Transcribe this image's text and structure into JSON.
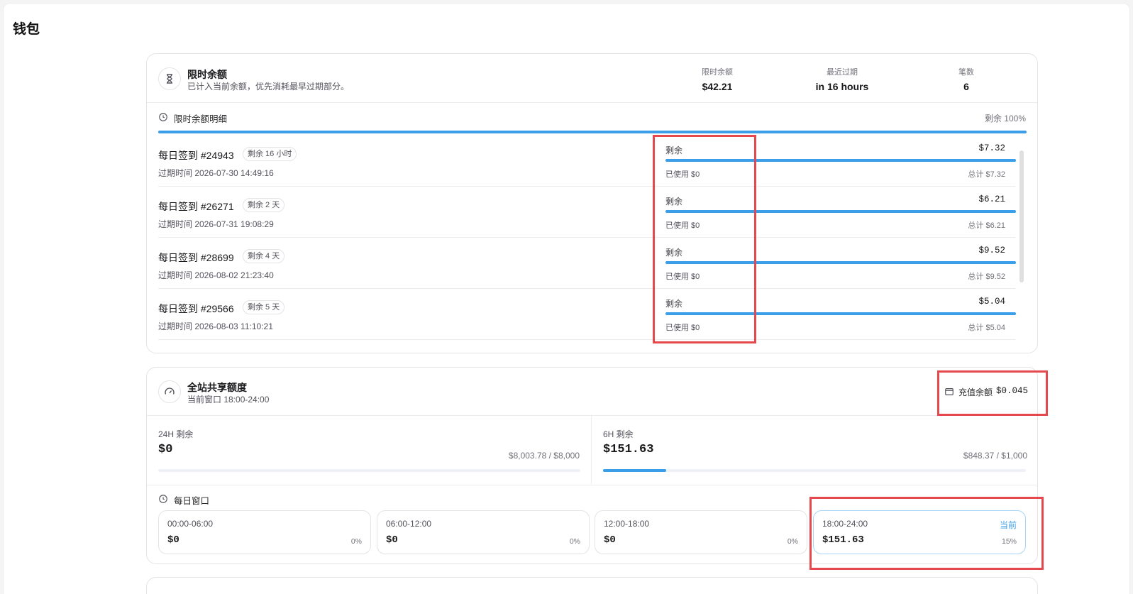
{
  "page": {
    "title": "钱包"
  },
  "limited": {
    "title": "限时余额",
    "subtitle": "已计入当前余额，优先消耗最早过期部分。",
    "stats": [
      {
        "label": "限时余额",
        "value": "$42.21"
      },
      {
        "label": "最近过期",
        "value": "in 16 hours"
      },
      {
        "label": "笔数",
        "value": "6"
      }
    ],
    "detail_title": "限时余额明细",
    "remaining_overall": "剩余 100%",
    "remaining_overall_pct": 100,
    "rows": [
      {
        "name": "每日签到 #24943",
        "badge": "剩余 16 小时",
        "expire": "过期时间 2026-07-30 14:49:16",
        "remain_label": "剩余",
        "remain_value": "$7.32",
        "used": "已使用 $0",
        "total": "总计 $7.32",
        "remain_pct": 100
      },
      {
        "name": "每日签到 #26271",
        "badge": "剩余 2 天",
        "expire": "过期时间 2026-07-31 19:08:29",
        "remain_label": "剩余",
        "remain_value": "$6.21",
        "used": "已使用 $0",
        "total": "总计 $6.21",
        "remain_pct": 100
      },
      {
        "name": "每日签到 #28699",
        "badge": "剩余 4 天",
        "expire": "过期时间 2026-08-02 21:23:40",
        "remain_label": "剩余",
        "remain_value": "$9.52",
        "used": "已使用 $0",
        "total": "总计 $9.52",
        "remain_pct": 100
      },
      {
        "name": "每日签到 #29566",
        "badge": "剩余 5 天",
        "expire": "过期时间 2026-08-03 11:10:21",
        "remain_label": "剩余",
        "remain_value": "$5.04",
        "used": "已使用 $0",
        "total": "总计 $5.04",
        "remain_pct": 100
      }
    ]
  },
  "shared": {
    "title": "全站共享额度",
    "subtitle": "当前窗口 18:00-24:00",
    "recharge_label": "充值余额",
    "recharge_value": "$0.045",
    "panes": [
      {
        "label": "24H 剩余",
        "value": "$0",
        "ratio": "$8,003.78 / $8,000",
        "remain_pct": 0
      },
      {
        "label": "6H 剩余",
        "value": "$151.63",
        "ratio": "$848.37 / $1,000",
        "remain_pct": 15
      }
    ],
    "daily_title": "每日窗口",
    "slots": [
      {
        "time": "00:00-06:00",
        "value": "$0",
        "pct": "0%",
        "current": ""
      },
      {
        "time": "06:00-12:00",
        "value": "$0",
        "pct": "0%",
        "current": ""
      },
      {
        "time": "12:00-18:00",
        "value": "$0",
        "pct": "0%",
        "current": ""
      },
      {
        "time": "18:00-24:00",
        "value": "$151.63",
        "pct": "15%",
        "current": "当前"
      }
    ]
  },
  "icons": {
    "limited": "hourglass-icon",
    "detail": "clock-icon",
    "shared": "gauge-icon",
    "wallet": "wallet-icon",
    "daily": "clock-icon"
  },
  "colors": {
    "accent": "#3b9ee8",
    "highlight": "#e5484d"
  }
}
